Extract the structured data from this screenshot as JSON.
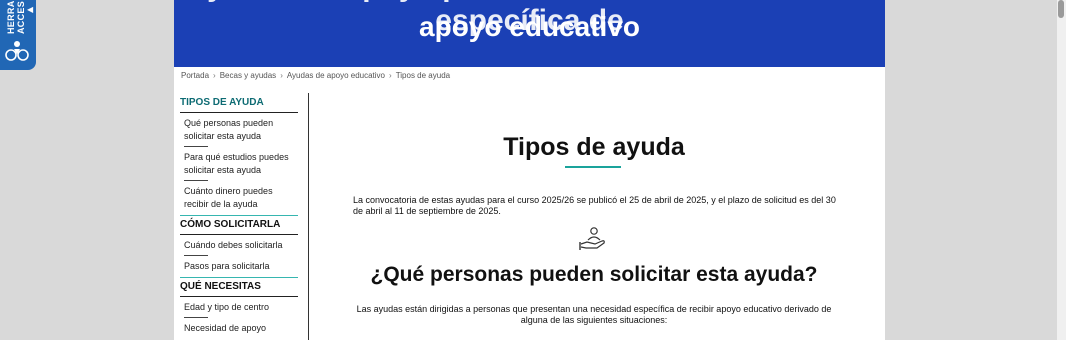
{
  "accessibility_tab": {
    "label": "HERRAMIENTAS ACCES",
    "arrow": "◀"
  },
  "hero": {
    "title_partial": "Ayudas de apoyo para alumnado con necesidad específica de",
    "title": "apoyo educativo"
  },
  "breadcrumb": [
    "Portada",
    "Becas y ayudas",
    "Ayudas de apoyo educativo",
    "Tipos de ayuda"
  ],
  "sidebar": {
    "sections": [
      {
        "heading": "TIPOS DE AYUDA",
        "items": [
          "Qué personas pueden solicitar esta ayuda",
          "Para qué estudios puedes solicitar esta ayuda",
          "Cuánto dinero puedes recibir de la ayuda"
        ]
      },
      {
        "heading": "CÓMO SOLICITARLA",
        "items": [
          "Cuándo debes solicitarla",
          "Pasos para solicitarla"
        ]
      },
      {
        "heading": "QUÉ NECESITAS",
        "items": [
          "Edad y tipo de centro",
          "Necesidad de apoyo"
        ]
      }
    ]
  },
  "main": {
    "title": "Tipos de ayuda",
    "intro": "La convocatoria de estas ayudas para el curso 2025/26 se publicó el 25 de abril de 2025, y el plazo de solicitud es del 30 de abril al 11 de septiembre de 2025.",
    "icon": "hand-holding-person-icon",
    "subtitle": "¿Qué personas pueden solicitar esta ayuda?",
    "subtext": "Las ayudas están dirigidas a personas que presentan una necesidad específica de recibir apoyo educativo derivado de alguna de las siguientes situaciones:"
  },
  "colors": {
    "hero_bg": "#1b40b5",
    "accent_teal": "#1aa39b",
    "access_tab": "#2167b5"
  }
}
